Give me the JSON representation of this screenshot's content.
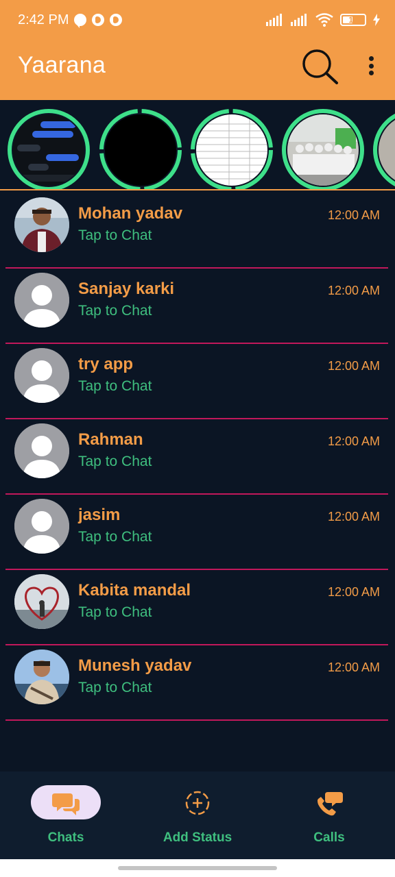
{
  "status_bar": {
    "time": "2:42 PM",
    "battery": "17"
  },
  "app_bar": {
    "title": "Yaarana"
  },
  "stories": [
    {
      "name": "status-1"
    },
    {
      "name": "status-2"
    },
    {
      "name": "status-3"
    },
    {
      "name": "status-4"
    },
    {
      "name": "status-5"
    }
  ],
  "chats": [
    {
      "name": "Mohan yadav",
      "message": "Tap to Chat",
      "time": "12:00 AM",
      "avatar": "photo"
    },
    {
      "name": "Sanjay karki",
      "message": "Tap to Chat",
      "time": "12:00 AM",
      "avatar": "placeholder"
    },
    {
      "name": "try app",
      "message": "Tap to Chat",
      "time": "12:00 AM",
      "avatar": "placeholder"
    },
    {
      "name": "Rahman",
      "message": "Tap to Chat",
      "time": "12:00 AM",
      "avatar": "placeholder"
    },
    {
      "name": "jasim",
      "message": "Tap to Chat",
      "time": "12:00 AM",
      "avatar": "placeholder"
    },
    {
      "name": "Kabita mandal",
      "message": "Tap to Chat",
      "time": "12:00 AM",
      "avatar": "photo"
    },
    {
      "name": "Munesh yadav",
      "message": "Tap to Chat",
      "time": "12:00 AM",
      "avatar": "photo"
    }
  ],
  "bottom_nav": {
    "chats": "Chats",
    "add_status": "Add Status",
    "calls": "Calls"
  },
  "colors": {
    "accent": "#f39c47",
    "green": "#3fbf7f",
    "divider": "#c2185b",
    "background": "#0b1524"
  }
}
